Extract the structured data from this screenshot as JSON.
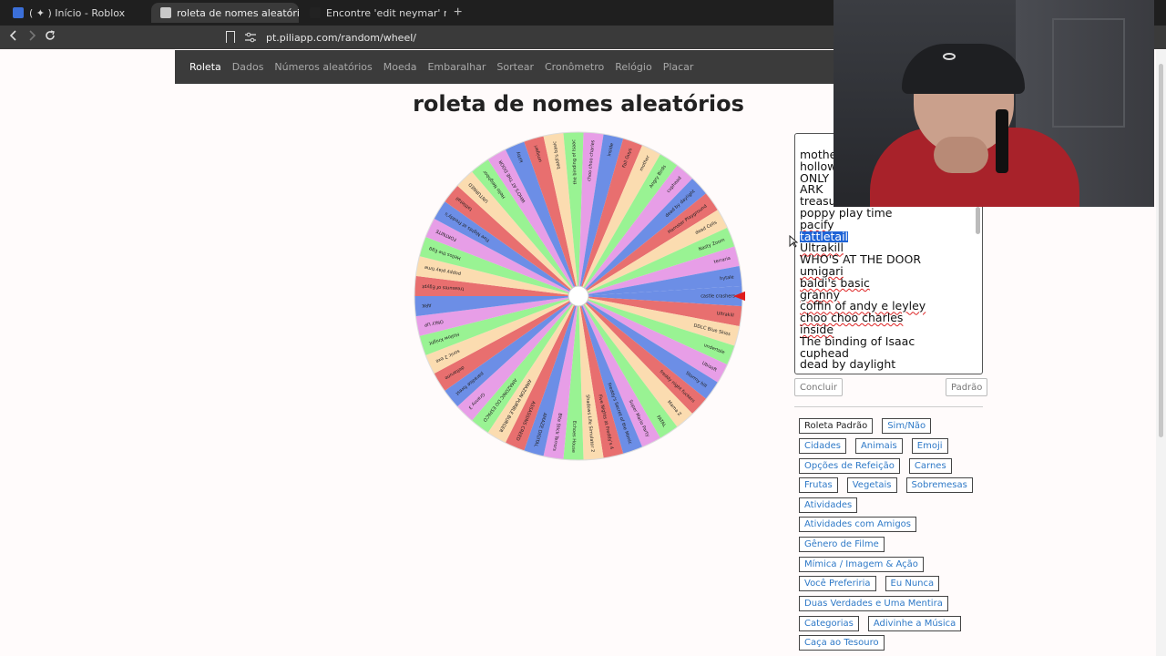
{
  "browser": {
    "tabs": [
      {
        "title": "( ✦ ) Início - Roblox",
        "fav_color": "#3b6fd8"
      },
      {
        "title": "roleta de nomes aleatórios",
        "fav_color": "#c8c8c8"
      },
      {
        "title": "Encontre 'edit neymar' no TikTok | Pe",
        "fav_color": "#222222"
      }
    ],
    "close_glyph": "✕",
    "new_tab_glyph": "+",
    "url": "pt.piliapp.com/random/wheel/",
    "menu_glyph": "⋮"
  },
  "nav": {
    "items": [
      "Roleta",
      "Dados",
      "Números aleatórios",
      "Moeda",
      "Embaralhar",
      "Sortear",
      "Cronômetro",
      "Relógio",
      "Placar"
    ],
    "active": "Roleta"
  },
  "page": {
    "title": "roleta de nomes aleatórios"
  },
  "wheel": {
    "colors": [
      "#6c8ee6",
      "#e86f6f",
      "#fbdcb0",
      "#99f393",
      "#e79ee7"
    ],
    "pointer_color": "#e01b1b",
    "labels": [
      "castle crashers",
      "Ultrakill",
      "DDLC Blue Skies",
      "undertale",
      "Ubisoft",
      "Stormy hill",
      "freddy night fuckers",
      "Mama Z",
      "FATAL",
      "Super Mario Party",
      "Freddy's Secret of the Mimic",
      "Five Nights at Freddy's 4",
      "Shadows Life Simulator 2",
      "Echoes House",
      "Bite Stick Terrors",
      "AMAZE DIGITAL",
      "ASSASSINS CREED",
      "AMAZON PURBLE BURGER",
      "AMAZONIC DO ESPACO",
      "Granny 3",
      "paradise forest",
      "deltarune",
      "sonic 2 exe",
      "Hollow Knight",
      "ONLY UP",
      "ARK",
      "treasures of Egypt",
      "poppy play time",
      "Hellos the Egg",
      "FORTNITE",
      "Five Nights at Freddy's",
      "tattletail",
      "UNTURNED",
      "Hello Neighbor",
      "WHO'S AT THE DOOR",
      "kirby",
      "umigari",
      "baldi's basic",
      "the binding of Isaac",
      "choo choo charles",
      "inside",
      "Fall Guys",
      "mother",
      "Angry Birds",
      "cuphead",
      "dead by daylight",
      "Hamster Playground",
      "dead Cells",
      "Nasty Zoom",
      "terraria",
      "hytale"
    ]
  },
  "names_box": {
    "lines": [
      {
        "text": "mother",
        "style": "plain"
      },
      {
        "text": "hollow",
        "style": "plain"
      },
      {
        "text": "ONLY U",
        "style": "plain"
      },
      {
        "text": "ARK",
        "style": "plain"
      },
      {
        "text": "treasur",
        "style": "plain"
      },
      {
        "text": "poppy play time",
        "style": "plain"
      },
      {
        "text": "pacify",
        "style": "spell"
      },
      {
        "text": "tattletail",
        "style": "selected"
      },
      {
        "text": " Ultrakill",
        "style": "spell"
      },
      {
        "text": "WHO'S AT THE DOOR",
        "style": "plain"
      },
      {
        "text": "umigari",
        "style": "spell"
      },
      {
        "text": "baldi's basic",
        "style": "spell"
      },
      {
        "text": "granny",
        "style": "spell"
      },
      {
        "text": " coffin of andy e leyley",
        "style": "spell"
      },
      {
        "text": "choo choo charles",
        "style": "spell"
      },
      {
        "text": "inside",
        "style": "spell"
      },
      {
        "text": "The binding of Isaac",
        "style": "plain"
      },
      {
        "text": "cuphead",
        "style": "plain"
      },
      {
        "text": "dead by daylight",
        "style": "plain"
      }
    ]
  },
  "controls": {
    "done": "Concluir",
    "default": "Padrão"
  },
  "presets": [
    {
      "label": "Roleta Padrão",
      "dark": true
    },
    {
      "label": "Sim/Não",
      "dark": false
    },
    {
      "label": "Cidades",
      "dark": false
    },
    {
      "label": "Animais",
      "dark": false
    },
    {
      "label": "Emoji",
      "dark": false
    },
    {
      "label": "Opções de Refeição",
      "dark": false
    },
    {
      "label": "Carnes",
      "dark": false
    },
    {
      "label": "Frutas",
      "dark": false
    },
    {
      "label": "Vegetais",
      "dark": false
    },
    {
      "label": "Sobremesas",
      "dark": false
    },
    {
      "label": "Atividades",
      "dark": false
    },
    {
      "label": "Atividades com Amigos",
      "dark": false
    },
    {
      "label": "Gênero de Filme",
      "dark": false
    },
    {
      "label": "Mímica / Imagem & Ação",
      "dark": false
    },
    {
      "label": "Você Preferiria",
      "dark": false
    },
    {
      "label": "Eu Nunca",
      "dark": false
    },
    {
      "label": "Duas Verdades e Uma Mentira",
      "dark": false
    },
    {
      "label": "Categorias",
      "dark": false
    },
    {
      "label": "Adivinhe a Música",
      "dark": false
    },
    {
      "label": "Caça ao Tesouro",
      "dark": false
    }
  ]
}
